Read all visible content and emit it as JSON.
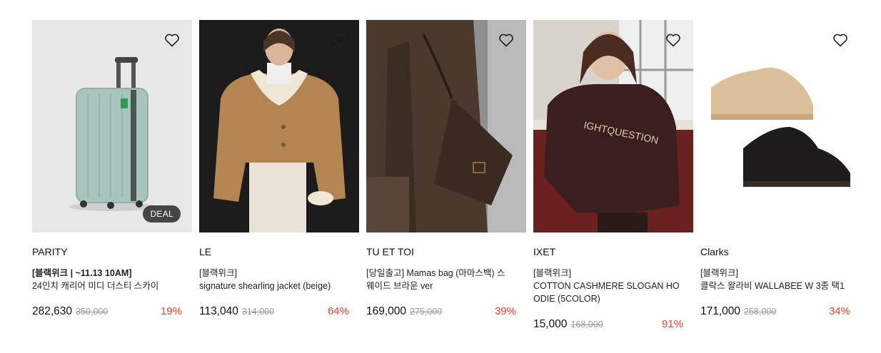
{
  "products": [
    {
      "brand": "PARITY",
      "tag": "[블랙위크 | ~11.13 10AM]",
      "name": "24인치 캐리어 미디 더스티 스카이",
      "price": "282,630",
      "original_price": "350,000",
      "discount": "19%",
      "badge": "DEAL",
      "image": "mint-suitcase-image"
    },
    {
      "brand": "LE",
      "tag": "[블랙위크]",
      "name": "signature shearling jacket (beige)",
      "price": "113,040",
      "original_price": "314,000",
      "discount": "64%",
      "image": "shearling-jacket-model-image"
    },
    {
      "brand": "TU ET TOI",
      "tag": "[당일출고] Mamas bag (마마스백) 스",
      "name": "웨이드 브라운 ver",
      "price": "169,000",
      "original_price": "275,000",
      "discount": "39%",
      "image": "brown-shoulder-bag-image"
    },
    {
      "brand": "IXET",
      "tag": "[블랙위크]",
      "name": "COTTON CASHMERE SLOGAN HOODIE (5COLOR)",
      "price": "15,000",
      "original_price": "168,000",
      "discount": "91%",
      "image": "brown-hoodie-model-image"
    },
    {
      "brand": "Clarks",
      "tag": "[블랙위크]",
      "name": "클락스 왈라비 WALLABEE W 3종 택1",
      "price": "171,000",
      "original_price": "258,000",
      "discount": "34%",
      "image": "wallabee-shoes-image"
    }
  ],
  "colors": {
    "discount": "#e8452a",
    "strike": "#9a9a9a"
  },
  "icons": {
    "wishlist": "heart-outline-icon"
  }
}
